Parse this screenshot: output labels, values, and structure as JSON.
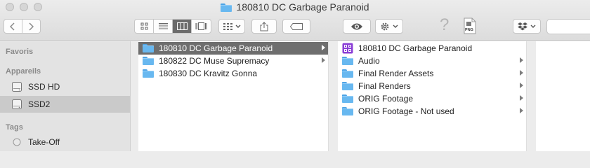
{
  "window": {
    "title": "180810 DC Garbage Paranoid"
  },
  "toolbar": {
    "back_icon": "chevron-left-icon",
    "forward_icon": "chevron-right-icon",
    "view_modes": [
      "icon-view",
      "list-view",
      "column-view",
      "gallery-view"
    ],
    "active_view": "column-view",
    "help_label": "?",
    "png_label": "PNG"
  },
  "sidebar": {
    "sections": [
      {
        "label": "Favoris",
        "items": []
      },
      {
        "label": "Appareils",
        "items": [
          {
            "label": "SSD HD",
            "icon": "disk-icon",
            "selected": false
          },
          {
            "label": "SSD2",
            "icon": "disk-icon",
            "selected": true
          }
        ]
      },
      {
        "label": "Tags",
        "items": [
          {
            "label": "Take-Off",
            "icon": "tag-circle-icon",
            "selected": false
          }
        ]
      }
    ]
  },
  "columns": [
    {
      "items": [
        {
          "label": "180810 DC Garbage Paranoid",
          "icon": "folder-icon",
          "selected": true,
          "has_children": true
        },
        {
          "label": "180822 DC Muse Supremacy",
          "icon": "folder-icon",
          "selected": false,
          "has_children": true
        },
        {
          "label": "180830 DC Kravitz Gonna",
          "icon": "folder-icon",
          "selected": false,
          "has_children": false
        }
      ]
    },
    {
      "items": [
        {
          "label": "180810 DC Garbage Paranoid",
          "icon": "premiere-project-icon",
          "selected": false,
          "has_children": false
        },
        {
          "label": "Audio",
          "icon": "folder-icon",
          "selected": false,
          "has_children": true
        },
        {
          "label": "Final Render Assets",
          "icon": "folder-icon",
          "selected": false,
          "has_children": true
        },
        {
          "label": "Final Renders",
          "icon": "folder-icon",
          "selected": false,
          "has_children": true
        },
        {
          "label": "ORIG Footage",
          "icon": "folder-icon",
          "selected": false,
          "has_children": true
        },
        {
          "label": "ORIG Footage - Not used",
          "icon": "folder-icon",
          "selected": false,
          "has_children": true
        }
      ]
    }
  ],
  "colors": {
    "selection": "#6e6e6e",
    "folder": "#68b8f0",
    "project_icon": "#8b3fd6"
  }
}
